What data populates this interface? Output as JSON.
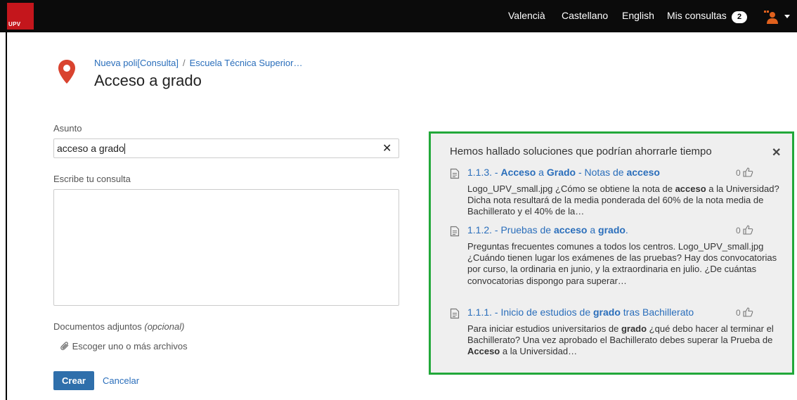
{
  "navbar": {
    "logo_text": "UPV",
    "languages": [
      "Valencià",
      "Castellano",
      "English"
    ],
    "my_queries_label": "Mis consultas",
    "my_queries_count": "2"
  },
  "header": {
    "breadcrumb": [
      "Nueva poli[Consulta]",
      "Escuela Técnica Superior…"
    ],
    "title": "Acceso a grado"
  },
  "form": {
    "subject_label": "Asunto",
    "subject_value": "acceso a grado",
    "body_label": "Escribe tu consulta",
    "attachments_label": "Documentos adjuntos",
    "attachments_optional": "(opcional)",
    "choose_files_label": "Escoger uno o más archivos",
    "create_label": "Crear",
    "cancel_label": "Cancelar"
  },
  "suggestions": {
    "title": "Hemos hallado soluciones que podrían ahorrarle tiempo",
    "results": [
      {
        "title_parts": [
          {
            "t": "1.1.3. - ",
            "b": false
          },
          {
            "t": "Acceso",
            "b": true
          },
          {
            "t": " a ",
            "b": false
          },
          {
            "t": "Grado",
            "b": true
          },
          {
            "t": " - Notas de ",
            "b": false
          },
          {
            "t": "acceso",
            "b": true
          }
        ],
        "likes": "0",
        "snippet_parts": [
          {
            "t": "Logo_UPV_small.jpg ¿Cómo se obtiene la nota de ",
            "b": false
          },
          {
            "t": "acceso",
            "b": true
          },
          {
            "t": " a la Universidad? Dicha nota resultará de la media ponderada del 60% de la nota media de Bachillerato y el 40% de la…",
            "b": false
          }
        ]
      },
      {
        "title_parts": [
          {
            "t": "1.1.2. - Pruebas de ",
            "b": false
          },
          {
            "t": "acceso",
            "b": true
          },
          {
            "t": " a ",
            "b": false
          },
          {
            "t": "grado",
            "b": true
          },
          {
            "t": ".",
            "b": false
          }
        ],
        "likes": "0",
        "snippet_parts": [
          {
            "t": "Preguntas frecuentes comunes a todos los centros. Logo_UPV_small.jpg ¿Cuándo tienen lugar los exámenes de las pruebas? Hay dos convocatorias por curso, la ordinaria en junio, y la extraordinaria en julio. ¿De cuántas convocatorias dispongo para superar…",
            "b": false
          }
        ]
      },
      {
        "title_parts": [
          {
            "t": "1.1.1. - Inicio de estudios de ",
            "b": false
          },
          {
            "t": "grado",
            "b": true
          },
          {
            "t": " tras Bachillerato",
            "b": false
          }
        ],
        "likes": "0",
        "snippet_parts": [
          {
            "t": "Para iniciar estudios universitarios de ",
            "b": false
          },
          {
            "t": "grado",
            "b": true
          },
          {
            "t": " ¿qué debo hacer al terminar el Bachillerato? Una vez aprobado el Bachillerato debes superar la Prueba de ",
            "b": false
          },
          {
            "t": "Acceso",
            "b": true
          },
          {
            "t": " a la Universidad…",
            "b": false
          }
        ]
      }
    ]
  },
  "colors": {
    "navbar_bg": "#0b0b0b",
    "brand_red": "#c4161c",
    "link_blue": "#2a6ebb",
    "primary_button": "#2f6fab",
    "highlight_border": "#22a83a",
    "panel_bg": "#efefef"
  },
  "icons": [
    "map-marker-icon",
    "close-icon",
    "document-icon",
    "thumbs-up-icon",
    "paperclip-icon",
    "user-icon",
    "caret-down-icon"
  ]
}
